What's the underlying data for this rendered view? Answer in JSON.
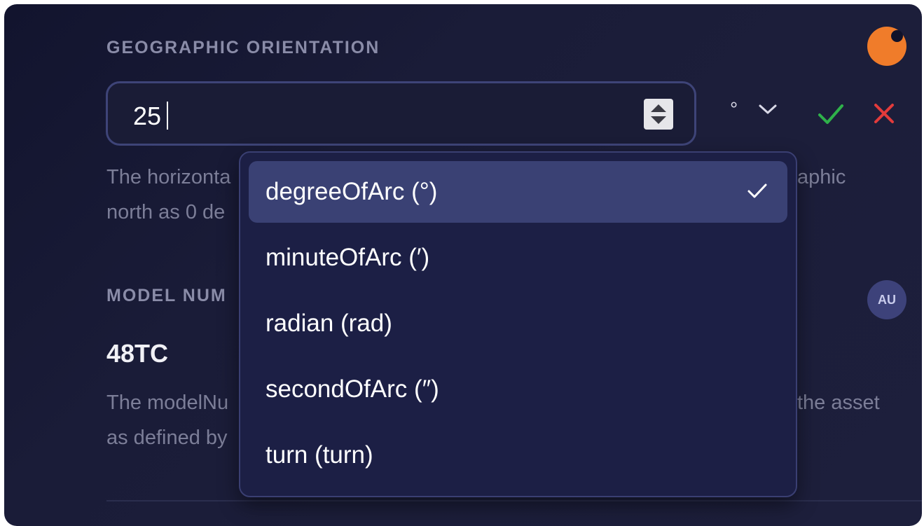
{
  "orientation": {
    "label": "GEOGRAPHIC ORIENTATION",
    "input_value": "25",
    "unit_symbol": "°",
    "description_line1": "The horizonta",
    "description_line1_tail": "aphic",
    "description_line2": "north as 0 de"
  },
  "model": {
    "label": "MODEL NUM",
    "value": "48TC",
    "avatar_initials": "AU",
    "description_line1": "The modelNu",
    "description_line1_tail": "the asset",
    "description_line2": "as defined by"
  },
  "unit_dropdown": {
    "options": [
      {
        "label": "degreeOfArc (°)",
        "selected": true
      },
      {
        "label": "minuteOfArc (′)",
        "selected": false
      },
      {
        "label": "radian (rad)",
        "selected": false
      },
      {
        "label": "secondOfArc (″)",
        "selected": false
      },
      {
        "label": "turn (turn)",
        "selected": false
      }
    ]
  },
  "icons": {
    "confirm": "check-icon",
    "cancel": "close-icon",
    "chevron": "chevron-down-icon",
    "selected_check": "check-icon"
  },
  "colors": {
    "background": "#1a1c38",
    "accent_orange": "#f07c2a",
    "confirm_green": "#2fb14a",
    "cancel_red": "#e23b3b",
    "dropdown_bg": "#1c1f45",
    "selected_bg": "#3a4174"
  }
}
